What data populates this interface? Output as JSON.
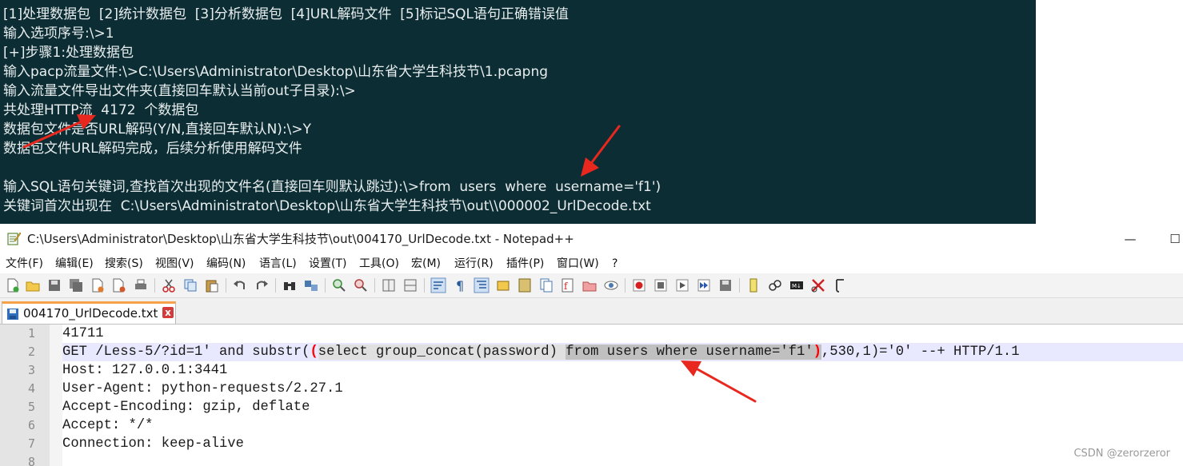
{
  "terminal": {
    "lines": [
      "[1]处理数据包  [2]统计数据包  [3]分析数据包  [4]URL解码文件  [5]标记SQL语句正确错误值",
      "输入选项序号:\\>1",
      "[+]步骤1:处理数据包",
      "输入pacp流量文件:\\>C:\\Users\\Administrator\\Desktop\\山东省大学生科技节\\1.pcapng",
      "输入流量文件导出文件夹(直接回车默认当前out子目录):\\>",
      "共处理HTTP流  4172  个数据包",
      "数据包文件是否URL解码(Y/N,直接回车默认N):\\>Y",
      "数据包文件URL解码完成，后续分析使用解码文件",
      "",
      "输入SQL语句关键词,查找首次出现的文件名(直接回车则默认跳过):\\>from  users  where  username='f1')",
      "关键词首次出现在  C:\\Users\\Administrator\\Desktop\\山东省大学生科技节\\out\\\\000002_UrlDecode.txt"
    ]
  },
  "notepad": {
    "title": "C:\\Users\\Administrator\\Desktop\\山东省大学生科技节\\out\\004170_UrlDecode.txt - Notepad++",
    "window_controls": {
      "minimize": "—",
      "maximize": "☐"
    },
    "menu": [
      "文件(F)",
      "编辑(E)",
      "搜索(S)",
      "视图(V)",
      "编码(N)",
      "语言(L)",
      "设置(T)",
      "工具(O)",
      "宏(M)",
      "运行(R)",
      "插件(P)",
      "窗口(W)",
      "?"
    ],
    "tab": {
      "label": "004170_UrlDecode.txt",
      "close": "x"
    },
    "line_numbers": [
      "1",
      "2",
      "3",
      "4",
      "5",
      "6",
      "7",
      "8"
    ],
    "code": {
      "line1": "41711",
      "line2": {
        "p1": "GET /Less-5/?id=1' and substr(",
        "p2": "(",
        "p3": "select group_concat(password) ",
        "p4": "from users where username='f1'",
        "p5": ")",
        "p6": ",530,1)='0' --+ HTTP/1.1"
      },
      "line3": "Host: 127.0.0.1:3441",
      "line4": "User-Agent: python-requests/2.27.1",
      "line5": "Accept-Encoding: gzip, deflate",
      "line6": "Accept: */*",
      "line7": "Connection: keep-alive",
      "line8": ""
    }
  },
  "watermark": "CSDN @zerorzeror",
  "colors": {
    "terminal_bg": "#0c2d33",
    "terminal_text": "#e8eeef",
    "current_line": "#e8e8ff",
    "found_highlight": "#c0c0c0",
    "arrow": "#e8281e",
    "tab_accent": "#f7a14a"
  }
}
